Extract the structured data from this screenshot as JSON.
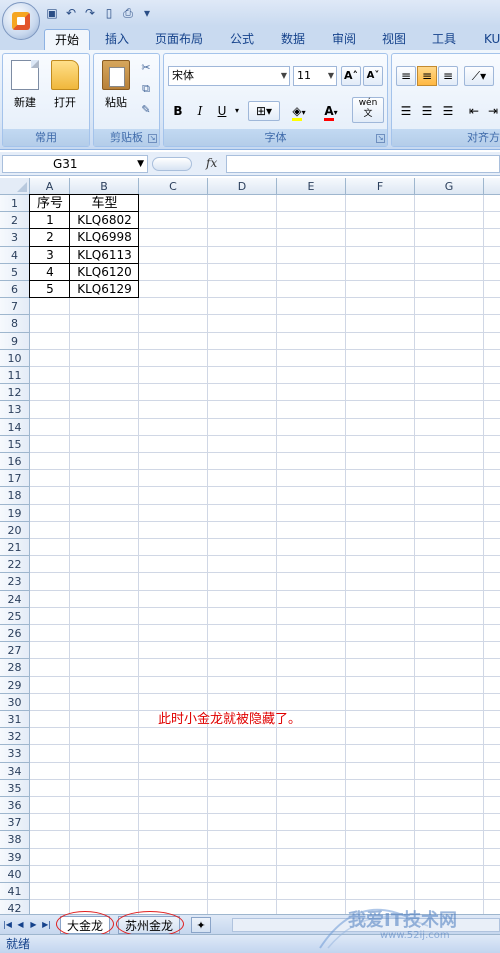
{
  "qat_icons": [
    "save-icon",
    "undo-icon",
    "redo-icon",
    "new-doc-icon",
    "print-preview-icon",
    "customize-icon"
  ],
  "ribbon_tabs": [
    {
      "label": "开始",
      "active": true
    },
    {
      "label": "插入"
    },
    {
      "label": "页面布局"
    },
    {
      "label": "公式"
    },
    {
      "label": "数据"
    },
    {
      "label": "审阅"
    },
    {
      "label": "视图"
    },
    {
      "label": "工具"
    },
    {
      "label": "KU"
    }
  ],
  "ribbon": {
    "common_group": {
      "label": "常用",
      "new_label": "新建",
      "open_label": "打开"
    },
    "clipboard_group": {
      "label": "剪贴板",
      "paste_label": "粘贴"
    },
    "font_group": {
      "label": "字体",
      "font_name": "宋体",
      "font_size": "11",
      "bold": "B",
      "italic": "I",
      "underline": "U",
      "font_color_letter": "A",
      "wen_label": "wén\n文"
    },
    "align_group": {
      "label": "对齐方"
    }
  },
  "formula_bar": {
    "name_box": "G31",
    "fx": "fx",
    "formula": ""
  },
  "columns": [
    "A",
    "B",
    "C",
    "D",
    "E",
    "F",
    "G"
  ],
  "rows": [
    "1",
    "2",
    "3",
    "4",
    "5",
    "6",
    "7",
    "8",
    "9",
    "10",
    "11",
    "12",
    "13",
    "14",
    "15",
    "16",
    "17",
    "18",
    "19",
    "20",
    "21",
    "22",
    "23",
    "24",
    "25",
    "26",
    "27",
    "28",
    "29",
    "30",
    "31",
    "32",
    "33",
    "34",
    "35",
    "36",
    "37",
    "38",
    "39",
    "40",
    "41",
    "42"
  ],
  "table": {
    "headers": [
      "序号",
      "车型"
    ],
    "rows": [
      [
        "1",
        "KLQ6802"
      ],
      [
        "2",
        "KLQ6998"
      ],
      [
        "3",
        "KLQ6113"
      ],
      [
        "4",
        "KLQ6120"
      ],
      [
        "5",
        "KLQ6129"
      ]
    ]
  },
  "annotation": "此时小金龙就被隐藏了。",
  "sheet_tabs": [
    "大金龙",
    "苏州金龙"
  ],
  "status": "就绪",
  "watermark": {
    "text": "我爱IT技术网",
    "url": "www.52ij.com"
  },
  "colors": {
    "annotation": "#e00000",
    "highlight_ellipse": "#e02020",
    "ribbon_blue": "#15428b"
  }
}
